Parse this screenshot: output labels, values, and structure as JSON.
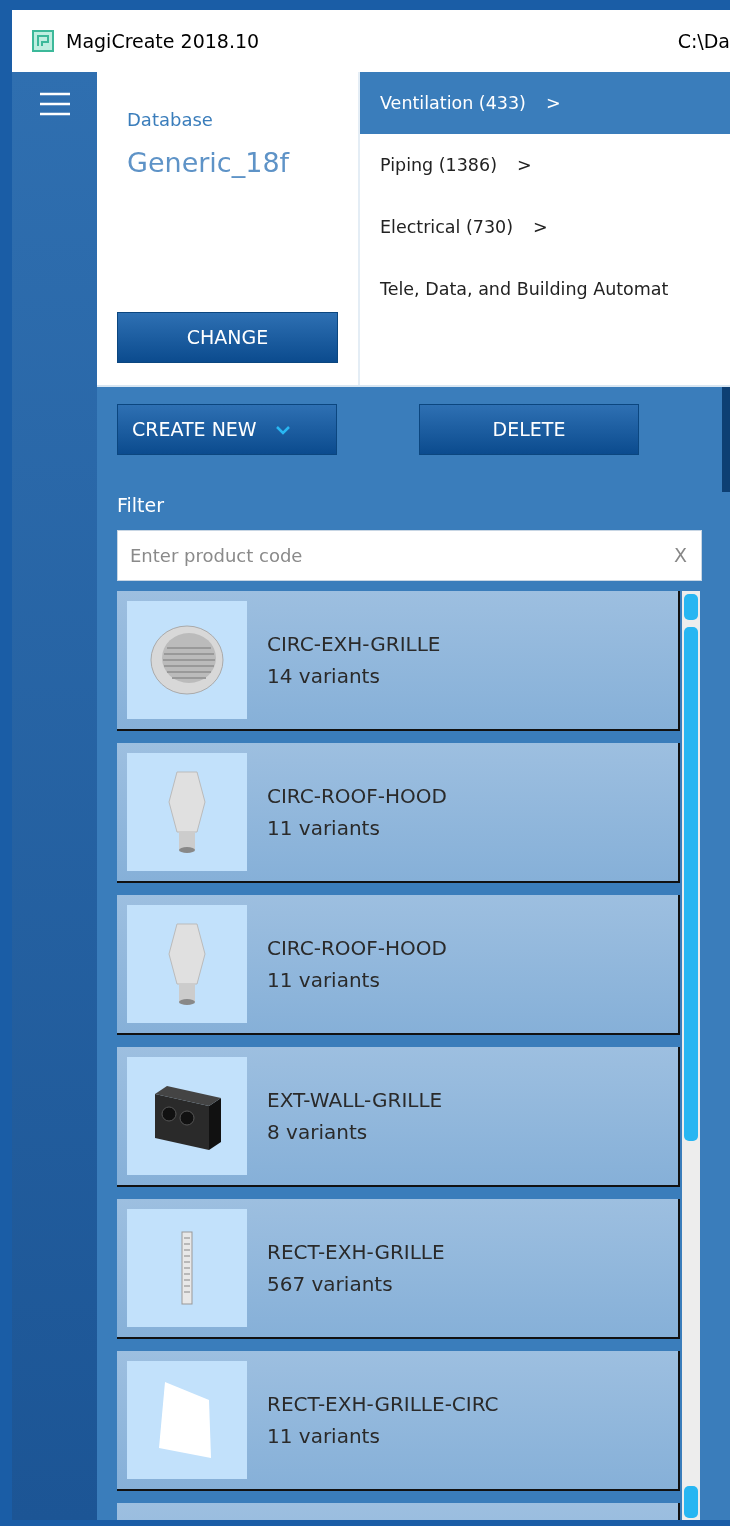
{
  "window": {
    "title": "MagiCreate 2018.10",
    "path": "C:\\Da"
  },
  "database": {
    "label": "Database",
    "name": "Generic_18f",
    "button": "CHANGE"
  },
  "categories": [
    {
      "label": "Ventilation (433)",
      "arrow": ">",
      "selected": true
    },
    {
      "label": "Piping (1386)",
      "arrow": ">",
      "selected": false
    },
    {
      "label": "Electrical (730)",
      "arrow": ">",
      "selected": false
    },
    {
      "label": "Tele, Data, and Building Automat",
      "selected": false
    }
  ],
  "toolbar": {
    "create_button": "CREATE NEW",
    "delete_button": "DELETE"
  },
  "filter": {
    "label": "Filter",
    "placeholder": "Enter product code",
    "clear": "X"
  },
  "products": [
    {
      "name": "CIRC-EXH-GRILLE",
      "variants": "14 variants",
      "kind": "round-grille"
    },
    {
      "name": "CIRC-ROOF-HOOD",
      "variants": "11 variants",
      "kind": "roof-hood"
    },
    {
      "name": "CIRC-ROOF-HOOD",
      "variants": "11 variants",
      "kind": "roof-hood"
    },
    {
      "name": "EXT-WALL-GRILLE",
      "variants": "8 variants",
      "kind": "wall-grille"
    },
    {
      "name": "RECT-EXH-GRILLE",
      "variants": "567 variants",
      "kind": "slim-grille"
    },
    {
      "name": "RECT-EXH-GRILLE-CIRC",
      "variants": "11 variants",
      "kind": "panel"
    }
  ]
}
